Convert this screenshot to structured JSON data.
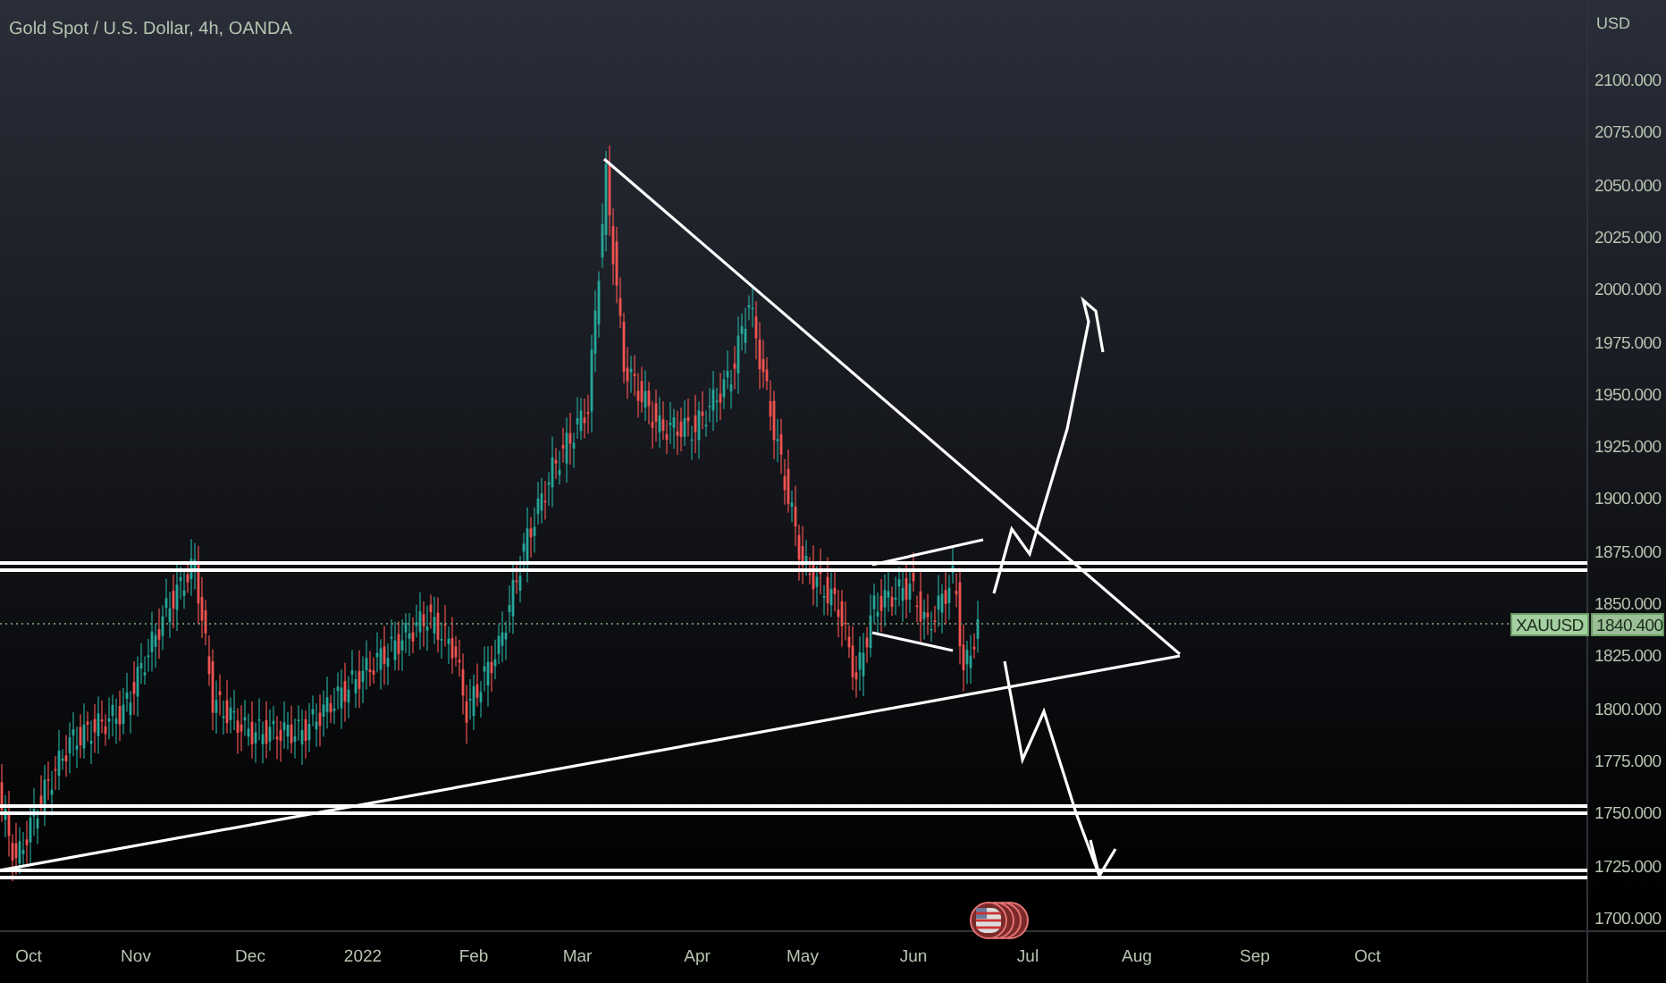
{
  "chart_header": {
    "title": "Gold Spot / U.S. Dollar, 4h, OANDA"
  },
  "price_axis": {
    "currency": "USD",
    "labels": [
      "2100.000",
      "2075.000",
      "2050.000",
      "2025.000",
      "2000.000",
      "1975.000",
      "1950.000",
      "1925.000",
      "1900.000",
      "1875.000",
      "1850.000",
      "1825.000",
      "1800.000",
      "1775.000",
      "1750.000",
      "1725.000",
      "1700.000"
    ]
  },
  "last_price": {
    "symbol": "XAUUSD",
    "price": "1840.400"
  },
  "time_axis": {
    "labels": [
      "Oct",
      "Nov",
      "Dec",
      "2022",
      "Feb",
      "Mar",
      "Apr",
      "May",
      "Jun",
      "Jul",
      "Aug",
      "Sep",
      "Oct"
    ]
  }
}
